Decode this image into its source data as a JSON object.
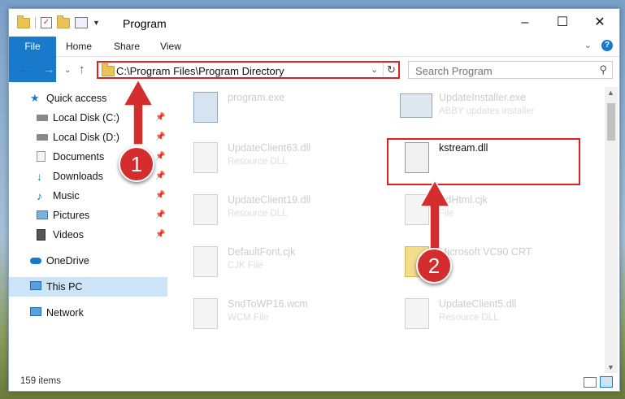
{
  "window": {
    "title": "Program",
    "min_icon": "minimize-icon",
    "max_icon": "maximize-icon",
    "close_icon": "close-icon"
  },
  "ribbon": {
    "tabs": [
      "File",
      "Home",
      "Share",
      "View"
    ],
    "help": "?"
  },
  "address": {
    "path": "C:\\Program Files\\Program Directory"
  },
  "search": {
    "placeholder": "Search Program"
  },
  "nav": {
    "items": [
      {
        "label": "Quick access"
      },
      {
        "label": "Local Disk (C:)"
      },
      {
        "label": "Local Disk (D:)"
      },
      {
        "label": "Documents"
      },
      {
        "label": "Downloads"
      },
      {
        "label": "Music"
      },
      {
        "label": "Pictures"
      },
      {
        "label": "Videos"
      },
      {
        "label": "OneDrive"
      },
      {
        "label": "This PC"
      },
      {
        "label": "Network"
      }
    ]
  },
  "files": [
    {
      "name": "program.exe",
      "desc": ""
    },
    {
      "name": "UpdateInstaller.exe",
      "desc": "ABBY updates installer"
    },
    {
      "name": "UpdateClient63.dll",
      "desc": "Resource DLL"
    },
    {
      "name": "kstream.dll",
      "desc": ""
    },
    {
      "name": "UpdateClient19.dll",
      "desc": "Resource DLL"
    },
    {
      "name": "EdHtml.cjk",
      "desc": "File"
    },
    {
      "name": "DefaultFont.cjk",
      "desc": "CJK File"
    },
    {
      "name": "Microsoft VC90 CRT",
      "desc": ""
    },
    {
      "name": "SndToWP16.wcm",
      "desc": "WCM File"
    },
    {
      "name": "UpdateClient5.dll",
      "desc": "Resource DLL"
    }
  ],
  "status": {
    "count": "159 items"
  },
  "annotations": {
    "step1": "1",
    "step2": "2",
    "color": "#d42d2d"
  }
}
